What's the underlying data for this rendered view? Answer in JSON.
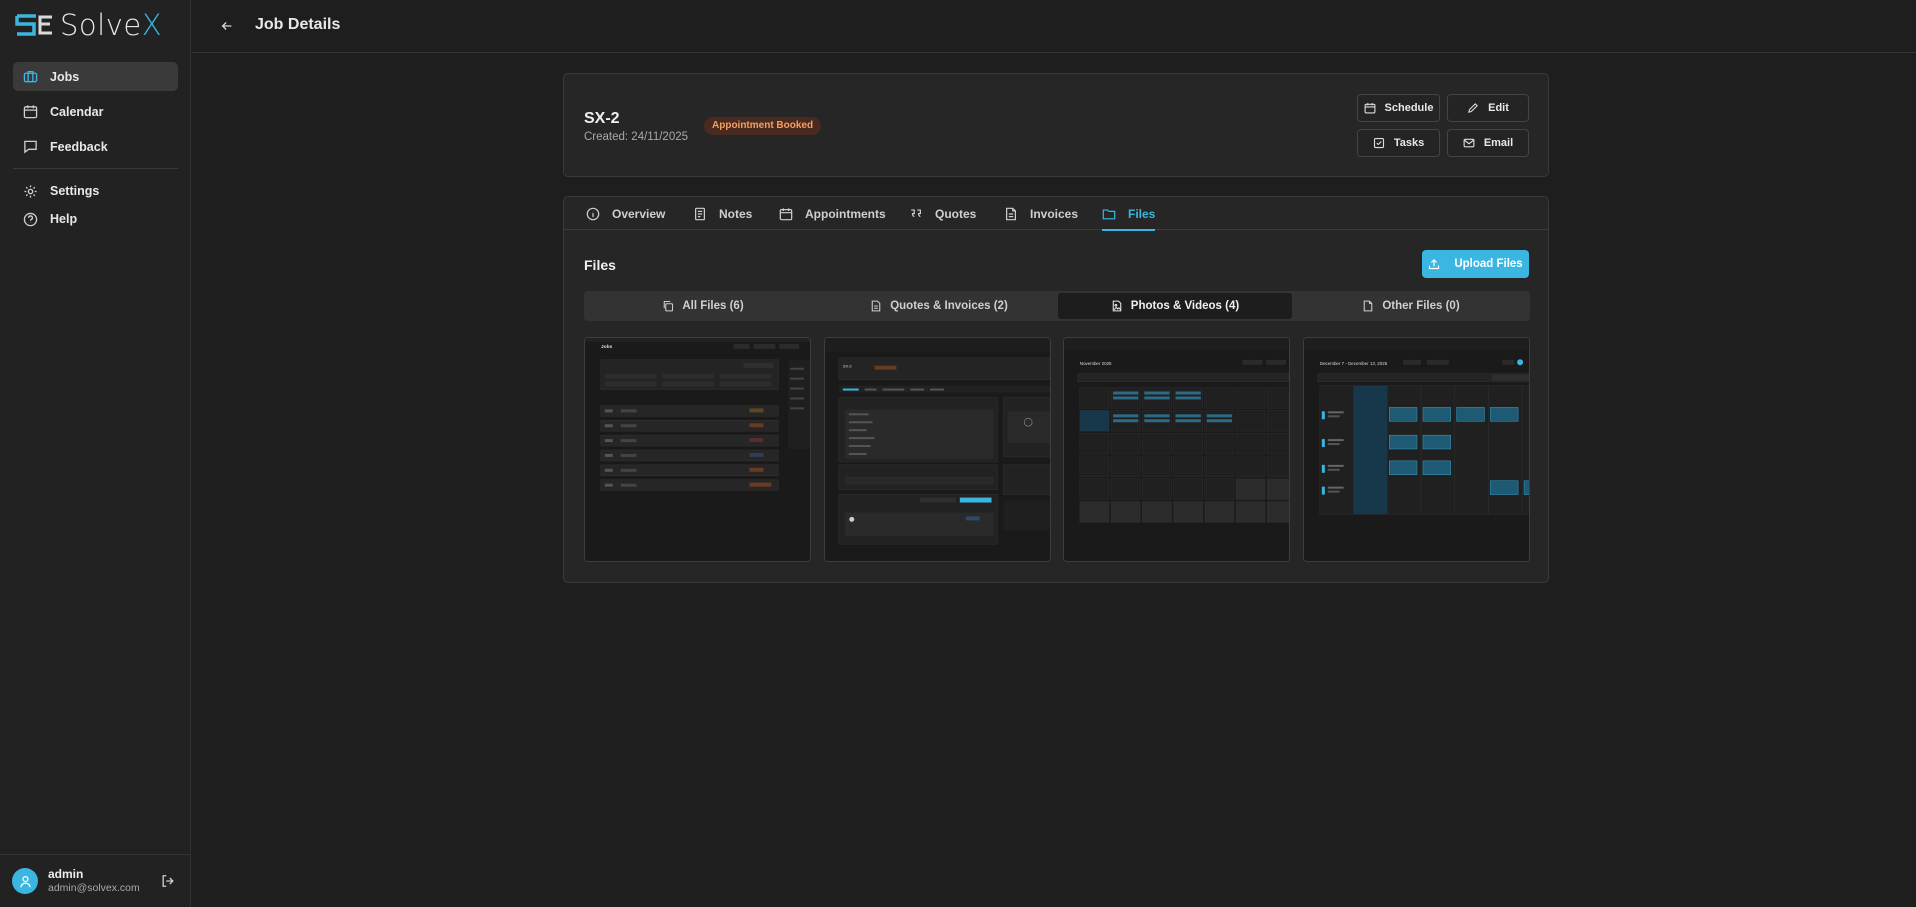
{
  "brand": {
    "name_prefix": "Solve",
    "name_suffix": "X",
    "accent": "#3ab6e0"
  },
  "sidebar": {
    "items": [
      {
        "label": "Jobs",
        "icon": "briefcase-icon",
        "active": true
      },
      {
        "label": "Calendar",
        "icon": "calendar-icon"
      },
      {
        "label": "Feedback",
        "icon": "message-icon"
      }
    ],
    "secondary": [
      {
        "label": "Settings",
        "icon": "gear-icon"
      },
      {
        "label": "Help",
        "icon": "help-circle-icon"
      }
    ],
    "user": {
      "name": "admin",
      "email": "admin@solvex.com"
    }
  },
  "header": {
    "title": "Job Details"
  },
  "job": {
    "id": "SX-2",
    "created": "Created: 24/11/2025",
    "status": "Appointment Booked",
    "status_color": "#f3a064",
    "actions": {
      "schedule": "Schedule",
      "edit": "Edit",
      "tasks": "Tasks",
      "email": "Email"
    }
  },
  "tabs": [
    {
      "label": "Overview",
      "icon": "info-icon"
    },
    {
      "label": "Notes",
      "icon": "notes-icon"
    },
    {
      "label": "Appointments",
      "icon": "calendar-icon"
    },
    {
      "label": "Quotes",
      "icon": "quote-icon"
    },
    {
      "label": "Invoices",
      "icon": "invoice-icon"
    },
    {
      "label": "Files",
      "icon": "folder-icon",
      "active": true
    }
  ],
  "files": {
    "title": "Files",
    "upload_label": "Upload Files",
    "filters": [
      {
        "label": "All Files (6)",
        "icon": "copy-icon"
      },
      {
        "label": "Quotes & Invoices (2)",
        "icon": "document-icon"
      },
      {
        "label": "Photos & Videos (4)",
        "icon": "image-file-icon",
        "active": true
      },
      {
        "label": "Other Files (0)",
        "icon": "file-icon"
      }
    ],
    "thumbnails": [
      {
        "title": "Jobs"
      },
      {
        "title": "SX-2"
      },
      {
        "title": "November 2025"
      },
      {
        "title": "December 7 - December 13, 2025"
      }
    ]
  }
}
